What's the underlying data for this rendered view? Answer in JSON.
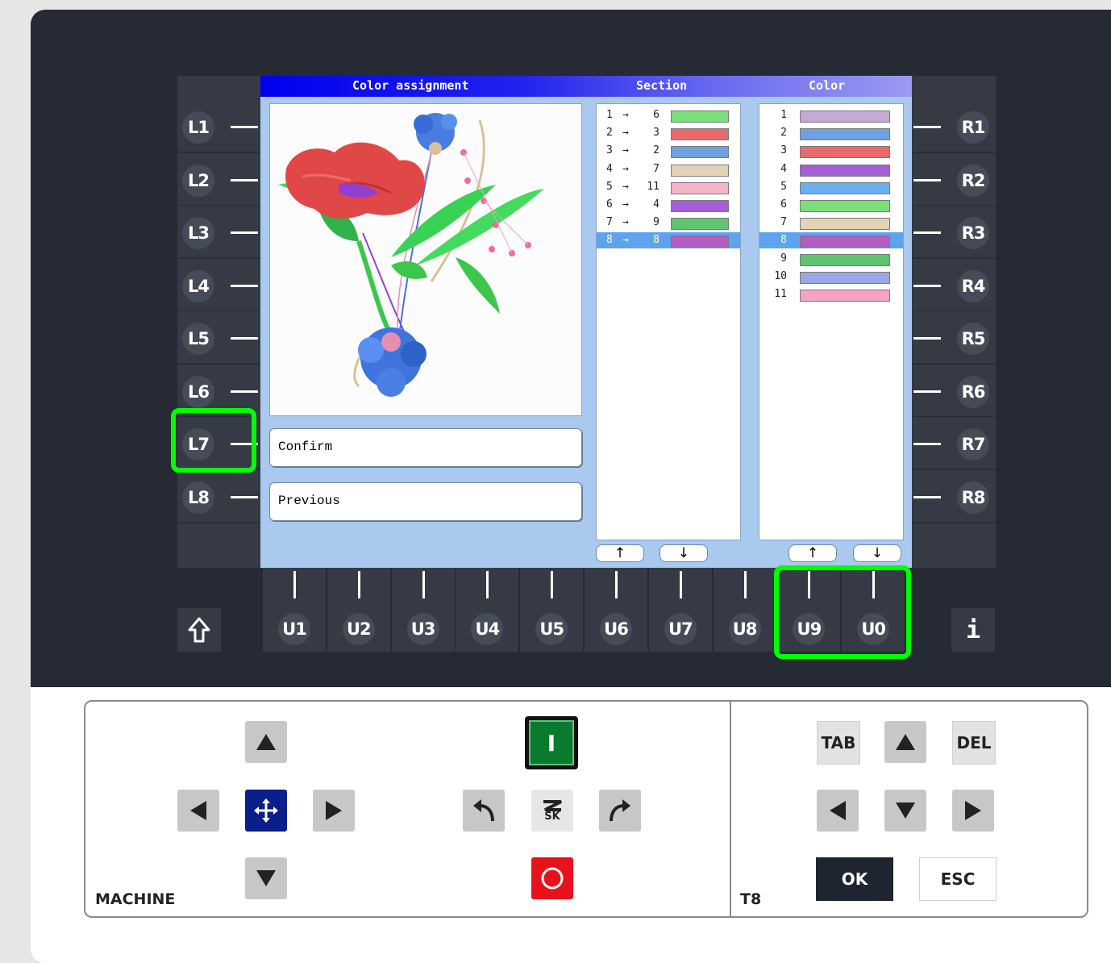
{
  "screen": {
    "title": "Color assignment",
    "section_header": "Section",
    "color_header": "Color",
    "buttons": {
      "confirm": "Confirm",
      "previous": "Previous"
    },
    "arrows": {
      "up": "↑",
      "down": "↓"
    },
    "section_rows": [
      {
        "from": "1",
        "arrow": "→",
        "to": "6",
        "color": "#79e079"
      },
      {
        "from": "2",
        "arrow": "→",
        "to": "3",
        "color": "#e86a6a"
      },
      {
        "from": "3",
        "arrow": "→",
        "to": "2",
        "color": "#6fa0e0"
      },
      {
        "from": "4",
        "arrow": "→",
        "to": "7",
        "color": "#e2d3b4"
      },
      {
        "from": "5",
        "arrow": "→",
        "to": "11",
        "color": "#f4b5c8"
      },
      {
        "from": "6",
        "arrow": "→",
        "to": "4",
        "color": "#a35ed8"
      },
      {
        "from": "7",
        "arrow": "→",
        "to": "9",
        "color": "#5fc46f"
      },
      {
        "from": "8",
        "arrow": "→",
        "to": "8",
        "color": "#b55cc0",
        "selected": true
      }
    ],
    "color_rows": [
      {
        "num": "1",
        "color": "#c8a8d6"
      },
      {
        "num": "2",
        "color": "#6fa0e0"
      },
      {
        "num": "3",
        "color": "#e86a6a"
      },
      {
        "num": "4",
        "color": "#a35ed8"
      },
      {
        "num": "5",
        "color": "#6ab0f0"
      },
      {
        "num": "6",
        "color": "#79e079"
      },
      {
        "num": "7",
        "color": "#e2d3b4"
      },
      {
        "num": "8",
        "color": "#b55cc0",
        "selected": true
      },
      {
        "num": "9",
        "color": "#5fc46f"
      },
      {
        "num": "10",
        "color": "#9aa8e8"
      },
      {
        "num": "11",
        "color": "#f4a3c0"
      }
    ]
  },
  "softkeys": {
    "left": [
      "L1",
      "L2",
      "L3",
      "L4",
      "L5",
      "L6",
      "L7",
      "L8"
    ],
    "right": [
      "R1",
      "R2",
      "R3",
      "R4",
      "R5",
      "R6",
      "R7",
      "R8"
    ],
    "bottom": [
      "U1",
      "U2",
      "U3",
      "U4",
      "U5",
      "U6",
      "U7",
      "U8",
      "U9",
      "U0"
    ],
    "shift_icon": "shift-arrow-icon",
    "info_label": "i"
  },
  "control_panel": {
    "machine_label": "MACHINE",
    "t8_label": "T8",
    "tab_label": "TAB",
    "del_label": "DEL",
    "ok_label": "OK",
    "esc_label": "ESC",
    "start_label": "I",
    "logo_text": "SK"
  },
  "colors": {
    "highlight": "#00ff00",
    "dark_bg": "#252a35",
    "key_bg": "#353a44",
    "screen_bg": "#a9c9ee",
    "selected_row": "#5da3ee",
    "start_green": "#0a7a2e",
    "stop_red": "#e8121d"
  }
}
